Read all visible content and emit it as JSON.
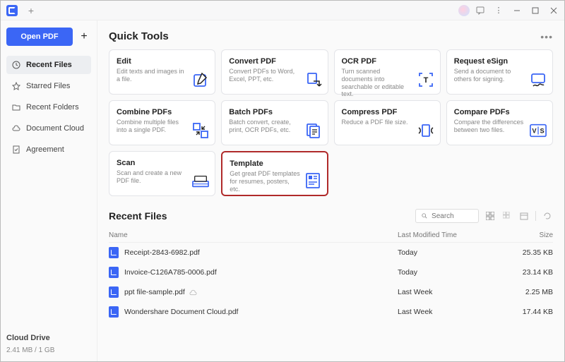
{
  "titlebar": {
    "app_icon": "pdf-app-logo",
    "new_tab": "+"
  },
  "sidebar": {
    "open_label": "Open PDF",
    "add_label": "+",
    "nav": [
      {
        "icon": "clock-icon",
        "label": "Recent Files",
        "active": true
      },
      {
        "icon": "star-icon",
        "label": "Starred Files",
        "active": false
      },
      {
        "icon": "folder-icon",
        "label": "Recent Folders",
        "active": false
      },
      {
        "icon": "cloud-icon",
        "label": "Document Cloud",
        "active": false
      },
      {
        "icon": "agreement-icon",
        "label": "Agreement",
        "active": false
      }
    ],
    "drive_label": "Cloud Drive",
    "drive_usage": "2.41 MB / 1 GB"
  },
  "quick_tools": {
    "title": "Quick Tools",
    "cards": [
      {
        "id": "edit",
        "title": "Edit",
        "desc": "Edit texts and images in a file.",
        "icon": "edit-icon",
        "highlight": false
      },
      {
        "id": "convert",
        "title": "Convert PDF",
        "desc": "Convert PDFs to Word, Excel, PPT, etc.",
        "icon": "convert-icon",
        "highlight": false
      },
      {
        "id": "ocr",
        "title": "OCR PDF",
        "desc": "Turn scanned documents into searchable or editable text.",
        "icon": "ocr-icon",
        "highlight": false
      },
      {
        "id": "esign",
        "title": "Request eSign",
        "desc": "Send a document to others for signing.",
        "icon": "esign-icon",
        "highlight": false
      },
      {
        "id": "combine",
        "title": "Combine PDFs",
        "desc": "Combine multiple files into a single PDF.",
        "icon": "combine-icon",
        "highlight": false
      },
      {
        "id": "batch",
        "title": "Batch PDFs",
        "desc": "Batch convert, create, print, OCR PDFs, etc.",
        "icon": "batch-icon",
        "highlight": false
      },
      {
        "id": "compress",
        "title": "Compress PDF",
        "desc": "Reduce a PDF file size.",
        "icon": "compress-icon",
        "highlight": false
      },
      {
        "id": "compare",
        "title": "Compare PDFs",
        "desc": "Compare the differences between two files.",
        "icon": "compare-icon",
        "highlight": false
      },
      {
        "id": "scan",
        "title": "Scan",
        "desc": "Scan and create a new PDF file.",
        "icon": "scan-icon",
        "highlight": false
      },
      {
        "id": "template",
        "title": "Template",
        "desc": "Get great PDF templates for resumes, posters, etc.",
        "icon": "template-icon",
        "highlight": true
      }
    ]
  },
  "recent_files": {
    "title": "Recent Files",
    "search_placeholder": "Search",
    "columns": {
      "name": "Name",
      "modified": "Last Modified Time",
      "size": "Size"
    },
    "rows": [
      {
        "name": "Receipt-2843-6982.pdf",
        "modified": "Today",
        "size": "25.35 KB",
        "cloud": false
      },
      {
        "name": "Invoice-C126A785-0006.pdf",
        "modified": "Today",
        "size": "23.14 KB",
        "cloud": false
      },
      {
        "name": "ppt file-sample.pdf",
        "modified": "Last Week",
        "size": "2.25 MB",
        "cloud": true
      },
      {
        "name": "Wondershare Document Cloud.pdf",
        "modified": "Last Week",
        "size": "17.44 KB",
        "cloud": false
      }
    ]
  }
}
